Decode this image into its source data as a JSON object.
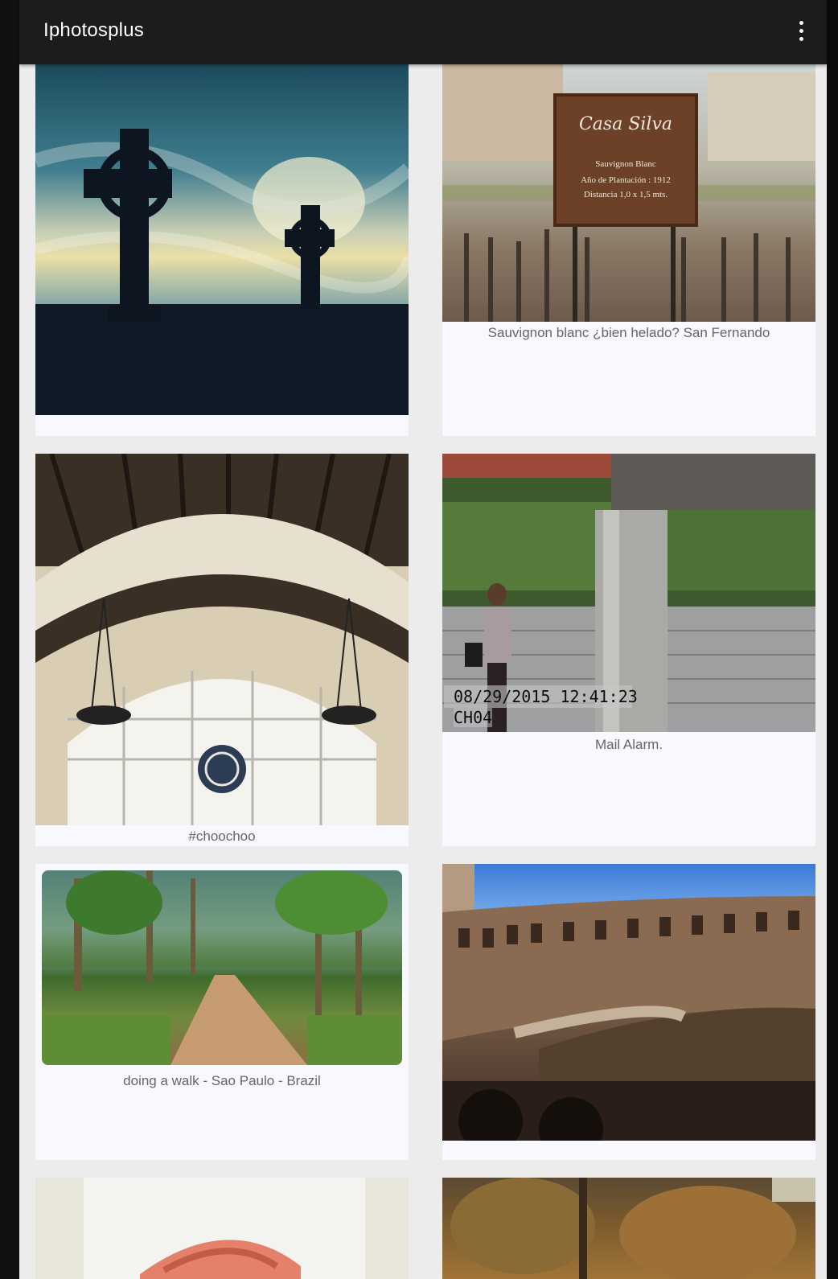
{
  "app_bar": {
    "title": "Iphotosplus",
    "menu_icon": "overflow-menu-icon"
  },
  "feed": {
    "items": [
      {
        "caption": ""
      },
      {
        "caption": "Sauvignon blanc ¿bien helado? San Fernando"
      },
      {
        "caption": "#choochoo"
      },
      {
        "caption": "Mail Alarm."
      },
      {
        "caption": "doing a walk - Sao Paulo - Brazil"
      },
      {
        "caption": ""
      },
      {
        "caption": ""
      },
      {
        "caption": ""
      }
    ]
  },
  "photo_text": {
    "sign_brand": "Casa Silva",
    "sign_line1": "Sauvignon Blanc",
    "sign_line2": "Año de Plantación : 1912",
    "sign_line3": "Distancia 1,0 x 1,5 mts.",
    "cam_timestamp": "08/29/2015 12:41:23",
    "cam_channel": "CH04"
  }
}
